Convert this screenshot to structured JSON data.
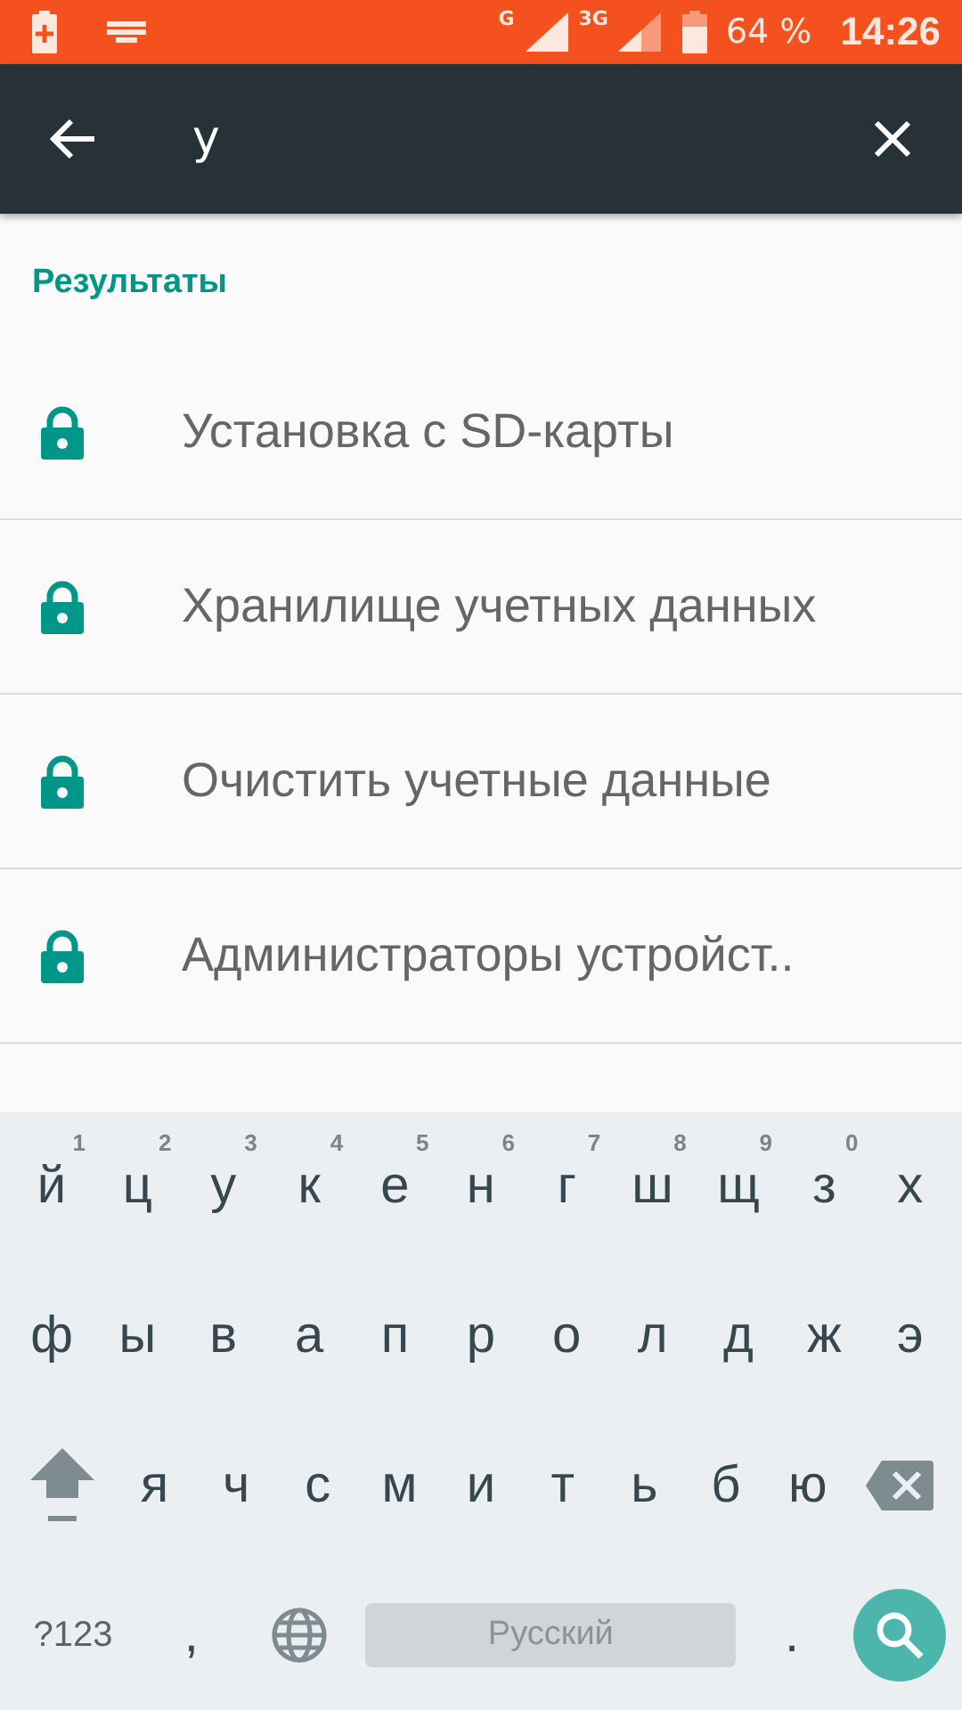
{
  "status_bar": {
    "network_1": "G",
    "network_2": "3G",
    "battery": "64 %",
    "time": "14:26"
  },
  "search": {
    "value": "у"
  },
  "section_title": "Результаты",
  "results": [
    {
      "label": "Установка с SD-карты"
    },
    {
      "label": "Хранилище учетных данных"
    },
    {
      "label": "Очистить учетные данные"
    },
    {
      "label": "Администраторы устройст.."
    }
  ],
  "keyboard": {
    "rows": [
      [
        {
          "kind": "letter",
          "label": "й",
          "hint": "1"
        },
        {
          "kind": "letter",
          "label": "ц",
          "hint": "2"
        },
        {
          "kind": "letter",
          "label": "у",
          "hint": "3"
        },
        {
          "kind": "letter",
          "label": "к",
          "hint": "4"
        },
        {
          "kind": "letter",
          "label": "е",
          "hint": "5"
        },
        {
          "kind": "letter",
          "label": "н",
          "hint": "6"
        },
        {
          "kind": "letter",
          "label": "г",
          "hint": "7"
        },
        {
          "kind": "letter",
          "label": "ш",
          "hint": "8"
        },
        {
          "kind": "letter",
          "label": "щ",
          "hint": "9"
        },
        {
          "kind": "letter",
          "label": "з",
          "hint": "0"
        },
        {
          "kind": "letter",
          "label": "х"
        }
      ],
      [
        {
          "kind": "letter",
          "label": "ф"
        },
        {
          "kind": "letter",
          "label": "ы"
        },
        {
          "kind": "letter",
          "label": "в"
        },
        {
          "kind": "letter",
          "label": "а"
        },
        {
          "kind": "letter",
          "label": "п"
        },
        {
          "kind": "letter",
          "label": "р"
        },
        {
          "kind": "letter",
          "label": "о"
        },
        {
          "kind": "letter",
          "label": "л"
        },
        {
          "kind": "letter",
          "label": "д"
        },
        {
          "kind": "letter",
          "label": "ж"
        },
        {
          "kind": "letter",
          "label": "э"
        }
      ],
      [
        {
          "kind": "shift"
        },
        {
          "kind": "letter",
          "label": "я"
        },
        {
          "kind": "letter",
          "label": "ч"
        },
        {
          "kind": "letter",
          "label": "с"
        },
        {
          "kind": "letter",
          "label": "м"
        },
        {
          "kind": "letter",
          "label": "и"
        },
        {
          "kind": "letter",
          "label": "т"
        },
        {
          "kind": "letter",
          "label": "ь"
        },
        {
          "kind": "letter",
          "label": "б"
        },
        {
          "kind": "letter",
          "label": "ю"
        },
        {
          "kind": "backspace"
        }
      ]
    ],
    "bottom_row": [
      {
        "kind": "symbols",
        "label": "?123"
      },
      {
        "kind": "letter",
        "label": ","
      },
      {
        "kind": "globe"
      },
      {
        "kind": "space",
        "label": "Русский"
      },
      {
        "kind": "letter",
        "label": "."
      },
      {
        "kind": "search"
      }
    ]
  }
}
